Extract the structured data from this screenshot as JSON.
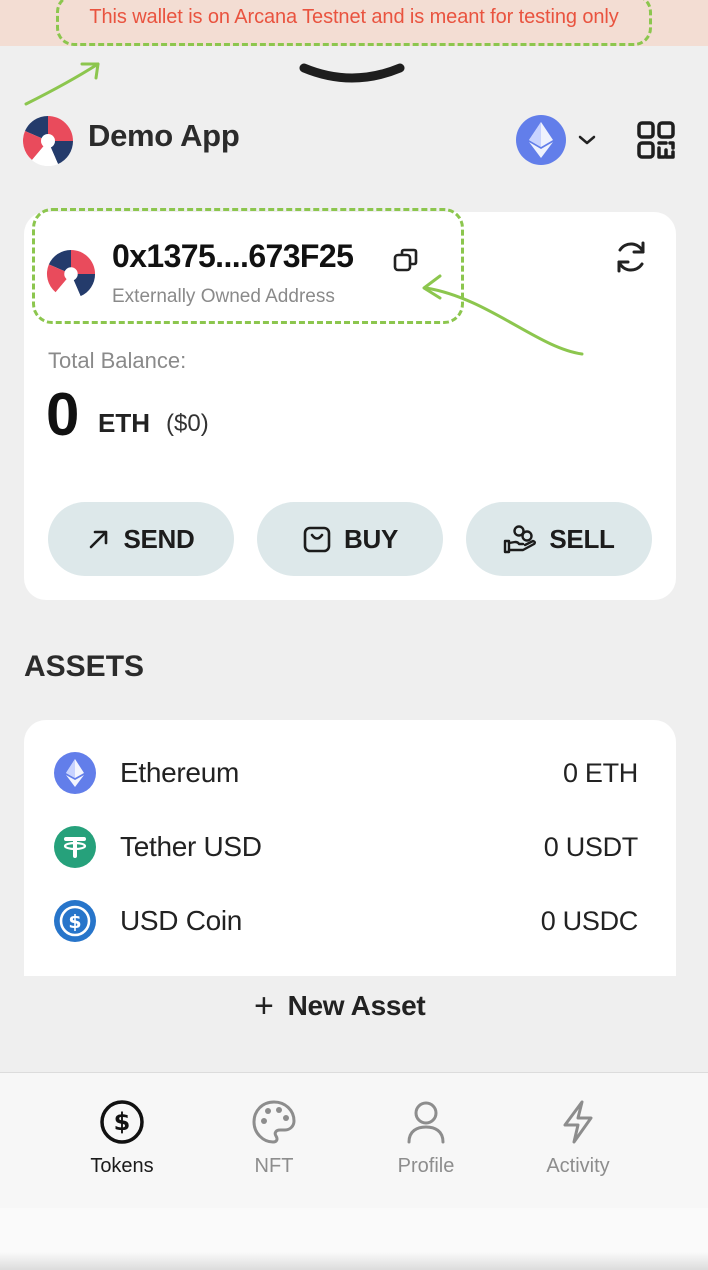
{
  "banner": {
    "text": "This wallet is on Arcana Testnet and is meant for testing only"
  },
  "header": {
    "app_name": "Demo App",
    "network_icon": "ethereum-icon"
  },
  "wallet": {
    "address": "0x1375....673F25",
    "address_type": "Externally Owned Address",
    "balance_label": "Total Balance:",
    "balance_value": "0",
    "balance_unit": "ETH",
    "balance_fiat": "($0)"
  },
  "actions": {
    "send": "SEND",
    "buy": "BUY",
    "sell": "SELL"
  },
  "assets": {
    "heading": "ASSETS",
    "items": [
      {
        "name": "Ethereum",
        "amount": "0 ETH",
        "icon": "ethereum-icon",
        "color": "#627eea"
      },
      {
        "name": "Tether USD",
        "amount": "0 USDT",
        "icon": "tether-icon",
        "color": "#26a17b"
      },
      {
        "name": "USD Coin",
        "amount": "0 USDC",
        "icon": "usdc-icon",
        "color": "#2775ca"
      }
    ],
    "new_asset": "New Asset"
  },
  "nav": {
    "tokens": "Tokens",
    "nft": "NFT",
    "profile": "Profile",
    "activity": "Activity"
  },
  "colors": {
    "banner_text": "#e9533f",
    "annotation": "#8cc64e",
    "accent_button": "#dde8ea"
  }
}
